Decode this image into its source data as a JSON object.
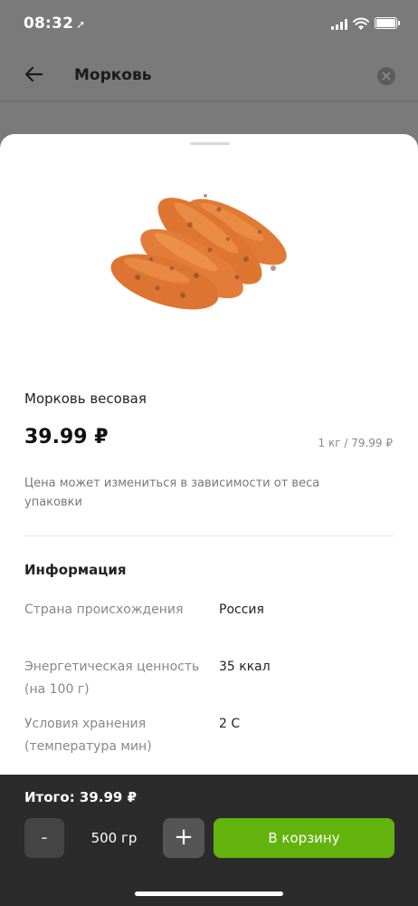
{
  "status_bar": {
    "time": "08:32",
    "location_arrow": "location-arrow-icon",
    "icons": [
      "signal-icon",
      "wifi-icon",
      "battery-icon"
    ]
  },
  "header": {
    "title": "Морковь",
    "back_icon": "arrow-left-icon",
    "clear_icon": "close-circle-icon"
  },
  "product": {
    "image": "carrots-image",
    "name": "Морковь весовая",
    "price": "39.99 ₽",
    "unit_price": "1 кг / 79.99 ₽",
    "price_note": "Цена может измениться в зависимости от веса упаковки"
  },
  "info": {
    "heading": "Информация",
    "rows": [
      {
        "label": "Страна происхождения",
        "value": "Россия"
      },
      {
        "label": "Энергетическая ценность (на 100 г)",
        "value": "35 ккал"
      },
      {
        "label": "Условия хранения (температура мин)",
        "value": "2 С"
      }
    ]
  },
  "bottom_bar": {
    "total": "Итого: 39.99 ₽",
    "minus_label": "-",
    "quantity": "500 гр",
    "plus_label": "+",
    "cart_label": "В корзину"
  },
  "colors": {
    "accent": "#63b30d",
    "bottom_bar_bg": "#2b2b2b",
    "overlay": "#7a7a7a"
  }
}
